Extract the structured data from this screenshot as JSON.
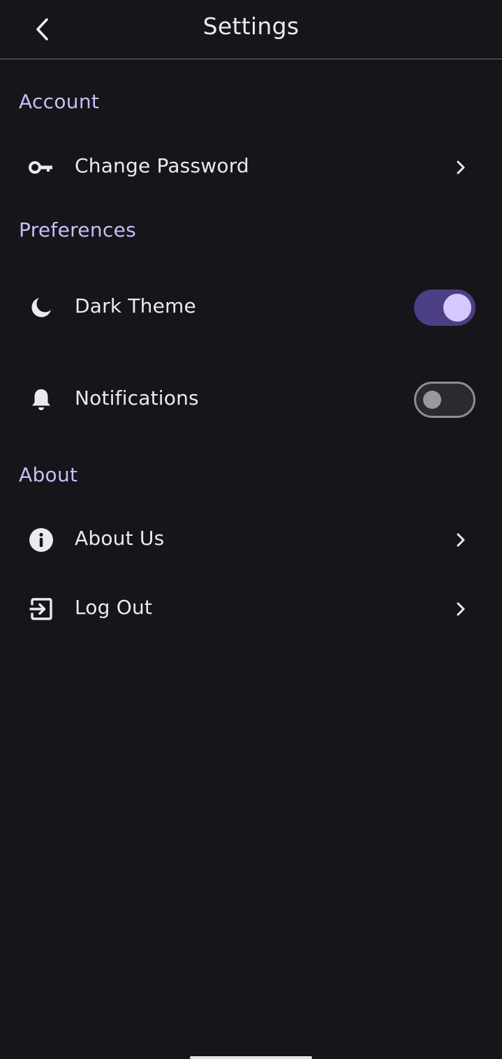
{
  "header": {
    "title": "Settings",
    "back_icon": "chevron-left-icon"
  },
  "sections": {
    "account": {
      "title": "Account",
      "change_password": {
        "label": "Change Password",
        "icon": "key-icon"
      }
    },
    "preferences": {
      "title": "Preferences",
      "dark_theme": {
        "label": "Dark Theme",
        "icon": "moon-icon",
        "enabled": true
      },
      "notifications": {
        "label": "Notifications",
        "icon": "bell-icon",
        "enabled": false
      }
    },
    "about": {
      "title": "About",
      "about_us": {
        "label": "About Us",
        "icon": "info-icon"
      },
      "log_out": {
        "label": "Log Out",
        "icon": "logout-icon"
      }
    }
  },
  "colors": {
    "background": "#16151a",
    "section_header": "#cbbcf7",
    "text": "#eceaf1",
    "toggle_on_track": "#4c3f86",
    "toggle_on_knob": "#d6c8ff",
    "toggle_off_track": "#2c2a31",
    "toggle_off_border": "#8f8c96"
  }
}
